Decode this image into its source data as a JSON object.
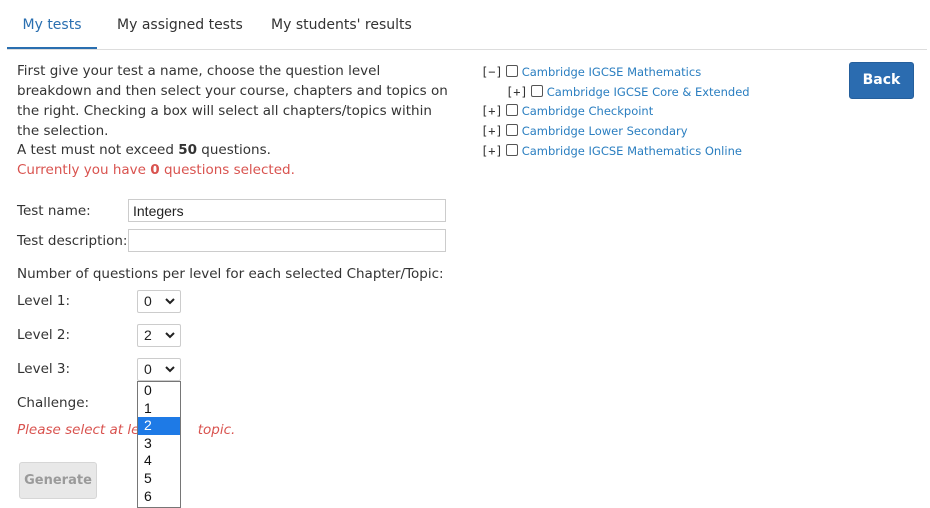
{
  "tabs": [
    {
      "label": "My tests",
      "active": true
    },
    {
      "label": "My assigned tests",
      "active": false
    },
    {
      "label": "My students' results",
      "active": false
    }
  ],
  "intro": "First give your test a name, choose the question level breakdown and then select your course, chapters and topics on the right. Checking a box will select all chapters/topics within the selection.",
  "limit": {
    "prefix": "A test must not exceed ",
    "count": "50",
    "suffix": " questions."
  },
  "current": {
    "prefix": "Currently you have ",
    "count": "0",
    "suffix": " questions selected."
  },
  "form": {
    "test_name_label": "Test name:",
    "test_name_value": "Integers",
    "test_description_label": "Test description:",
    "test_description_value": "",
    "per_level_label": "Number of questions per level for each selected Chapter/Topic:",
    "levels": [
      {
        "label": "Level 1:",
        "value": "0"
      },
      {
        "label": "Level 2:",
        "value": "2"
      },
      {
        "label": "Level 3:",
        "value": "0"
      }
    ],
    "challenge_label": "Challenge:",
    "error_visible_left": "Please select at lea",
    "error_visible_right": "topic.",
    "generate_label": "Generate"
  },
  "dropdown": {
    "options": [
      "0",
      "1",
      "2",
      "3",
      "4",
      "5",
      "6"
    ],
    "highlighted_index": 2
  },
  "tree": [
    {
      "toggle": "[−]",
      "label": "Cambridge IGCSE Mathematics",
      "checked": false
    },
    {
      "toggle": "[+]",
      "label": "Cambridge IGCSE Core & Extended",
      "checked": false
    },
    {
      "toggle": "[+]",
      "label": "Cambridge Checkpoint",
      "checked": false
    },
    {
      "toggle": "[+]",
      "label": "Cambridge Lower Secondary",
      "checked": false
    },
    {
      "toggle": "[+]",
      "label": "Cambridge IGCSE Mathematics Online",
      "checked": false
    }
  ],
  "back_label": "Back",
  "colors": {
    "accent": "#2a6fb0",
    "error": "#d9534f",
    "link": "#2a7ec0",
    "button": "#2b6cb0"
  }
}
